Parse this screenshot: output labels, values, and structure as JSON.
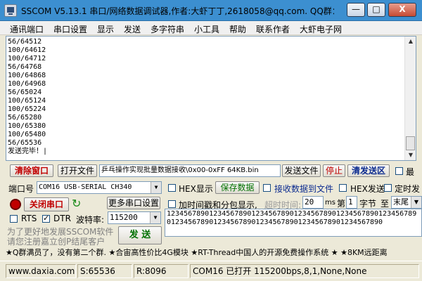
{
  "window": {
    "title": "SSCOM V5.13.1 串口/网络数据调试器,作者:大虾丁丁,2618058@qq.com. QQ群：",
    "minimize_glyph": "—",
    "maximize_glyph": "□",
    "close_glyph": "X"
  },
  "menu": [
    "通讯端口",
    "串口设置",
    "显示",
    "发送",
    "多字符串",
    "小工具",
    "帮助",
    "联系作者",
    "大虾电子网"
  ],
  "receive": {
    "lines": "56/64512\n100/64612\n100/64712\n56/64768\n100/64868\n100/64968\n56/65024\n100/65124\n100/65224\n56/65280\n100/65380\n100/65480\n56/65536\n发送完毕！|"
  },
  "toolbar": {
    "clear_window": "清除窗口",
    "open_file": "打开文件",
    "file_path": "乒乓操作实现批量数据接收\\0x00-0xFF 64KB.bin",
    "send_file": "发送文件",
    "stop": "停止",
    "clear_send_area": "清发送区",
    "last_checkbox_label": "最"
  },
  "port": {
    "port_label": "端口号",
    "port_value": "COM16 USB-SERIAL CH340",
    "close_port": "关闭串口",
    "more_settings": "更多串口设置",
    "rts_label": "RTS",
    "dtr_label": "DTR",
    "rts_checked": false,
    "dtr_checked": true,
    "baud_label": "波特率:",
    "baud_value": "115200"
  },
  "options": {
    "hex_display": "HEX显示",
    "save_data": "保存数据",
    "recv_to_file": "接收数据到文件",
    "hex_send": "HEX发送",
    "timed_send": "定时发",
    "timestamp": "加时间戳和分包显示,",
    "timeout_label": "超时时间:",
    "timeout_value": "20",
    "ms_label": "ms",
    "page_prefix": "第",
    "byte_index": "1",
    "byte_label": "字节",
    "to_label": "至",
    "end_value": "末尾"
  },
  "send": {
    "text": "12345678901234567890123456789012345678901234567890123456789012345678901234567890123456789012345678901234567890",
    "button": "发  送",
    "promo_line1": "为了更好地发展SSCOM软件",
    "promo_line2": "请您注册嘉立创P结尾客户"
  },
  "ad_text": "★Q群满员了，没有第二个群. ★合宙高性价比4G模块 ★RT-Thread中国人的开源免费操作系统 ★ ★8KM远距离",
  "status": {
    "website": "www.daxia.com",
    "sent": "S:65536",
    "received": "R:8096",
    "port_state": "COM16 已打开  115200bps,8,1,None,None"
  },
  "colors": {
    "title_bar": "#3c8fd0",
    "red_label": "#c00000",
    "green_label": "#007000"
  }
}
